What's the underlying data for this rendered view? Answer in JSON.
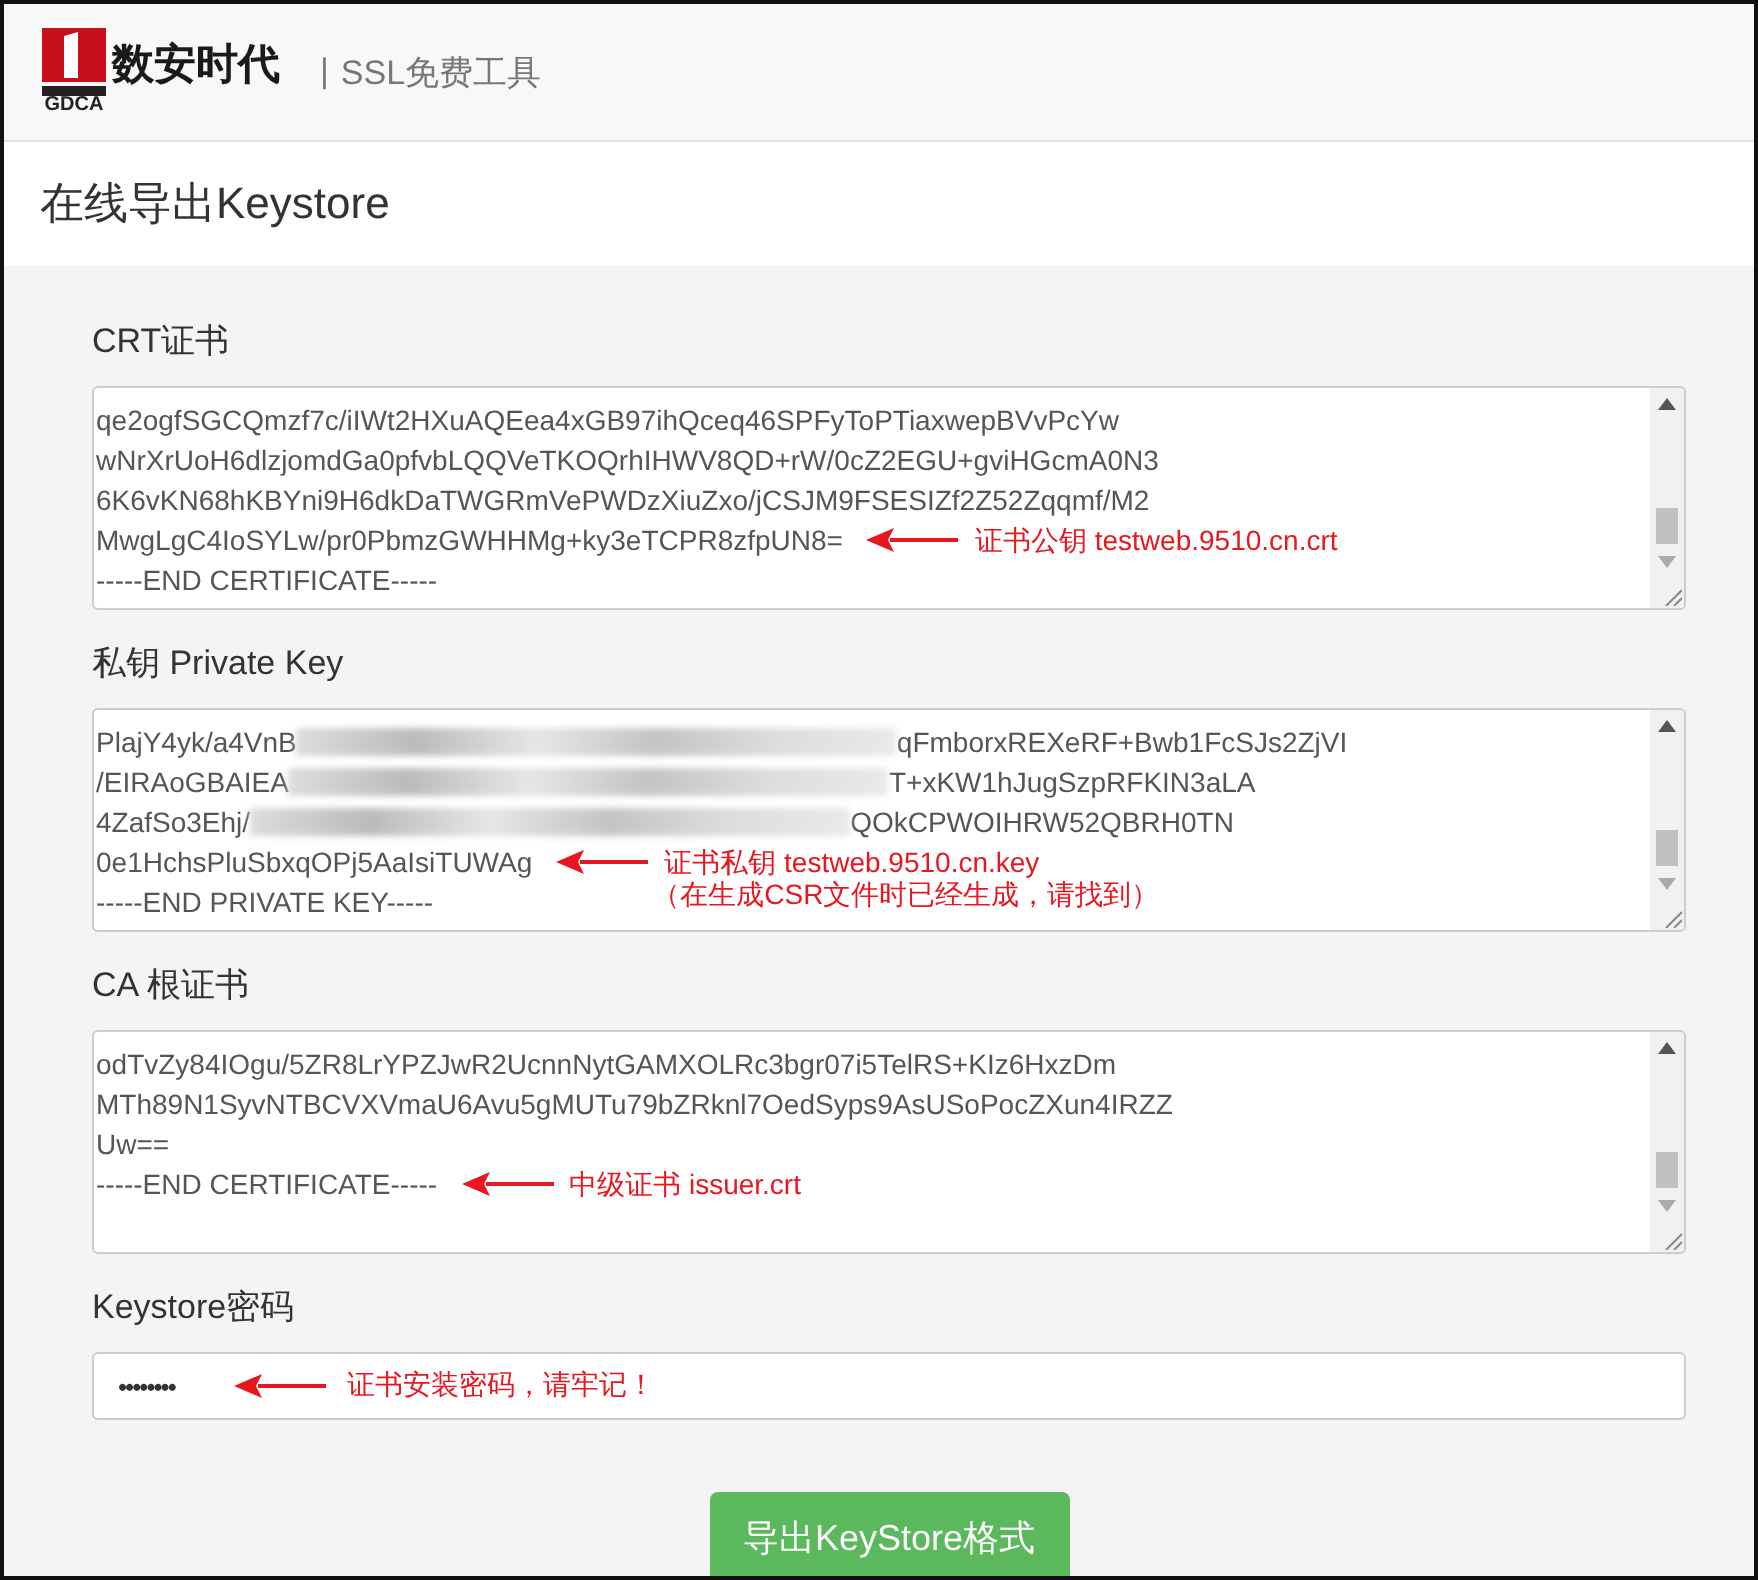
{
  "header": {
    "logo_mark": "GDCA",
    "logo_name": "数安时代",
    "separator": "|",
    "tagline": "SSL免费工具"
  },
  "page_title": "在线导出Keystore",
  "sections": [
    {
      "label": "CRT证书",
      "lines": [
        {
          "kind": "plain",
          "text": "qe2ogfSGCQmzf7c/iIWt2HXuAQEea4xGB97ihQceq46SPFyToPTiaxwepBVvPcYw"
        },
        {
          "kind": "plain",
          "text": "wNrXrUoH6dlzjomdGa0pfvbLQQVeTKOQrhIHWV8QD+rW/0cZ2EGU+gviHGcmA0N3"
        },
        {
          "kind": "plain",
          "text": "6K6vKN68hKBYni9H6dkDaTWGRmVePWDzXiuZxo/jCSJM9FSESIZf2Z52Zqqmf/M2"
        },
        {
          "kind": "plain",
          "text": "MwgLgC4IoSYLw/pr0PbmzGWHHMg+ky3eTCPR8zfpUN8=",
          "note": [
            "证书公钥  testweb.9510.cn.crt"
          ]
        },
        {
          "kind": "plain",
          "text": "-----END CERTIFICATE-----"
        }
      ]
    },
    {
      "label": "私钥 Private Key",
      "lines": [
        {
          "kind": "redacted",
          "text": "PlajY4yk/a4VnB",
          "end": "qFmborxREXeRF+Bwb1FcSJs2ZjVI"
        },
        {
          "kind": "redacted",
          "text": "/EIRAoGBAIEA",
          "end": "T+xKW1hJugSzpRFKIN3aLA"
        },
        {
          "kind": "redacted",
          "text": "4ZafSo3Ehj/",
          "end": "QOkCPWOIHRW52QBRH0TN"
        },
        {
          "kind": "plain",
          "text": "0e1HchsPluSbxqOPj5AaIsiTUWAg",
          "note": [
            "证书私钥 testweb.9510.cn.key",
            "（在生成CSR文件时已经生成，请找到）"
          ]
        },
        {
          "kind": "plain",
          "text": "-----END PRIVATE KEY-----"
        }
      ]
    },
    {
      "label": "CA 根证书",
      "lines": [
        {
          "kind": "plain",
          "text": "odTvZy84IOgu/5ZR8LrYPZJwR2UcnnNytGAMXOLRc3bgr07i5TelRS+KIz6HxzDm"
        },
        {
          "kind": "plain",
          "text": "MTh89N1SyvNTBCVXVmaU6Avu5gMUTu79bZRknl7OedSyps9AsUSoPocZXun4IRZZ"
        },
        {
          "kind": "plain",
          "text": "Uw=="
        },
        {
          "kind": "plain",
          "text": "-----END CERTIFICATE-----",
          "note": [
            "中级证书  issuer.crt"
          ]
        }
      ]
    }
  ],
  "password": {
    "label": "Keystore密码",
    "value": "••••••••",
    "note": "证书安装密码，请牢记！"
  },
  "submit_button": "导出KeyStore格式"
}
